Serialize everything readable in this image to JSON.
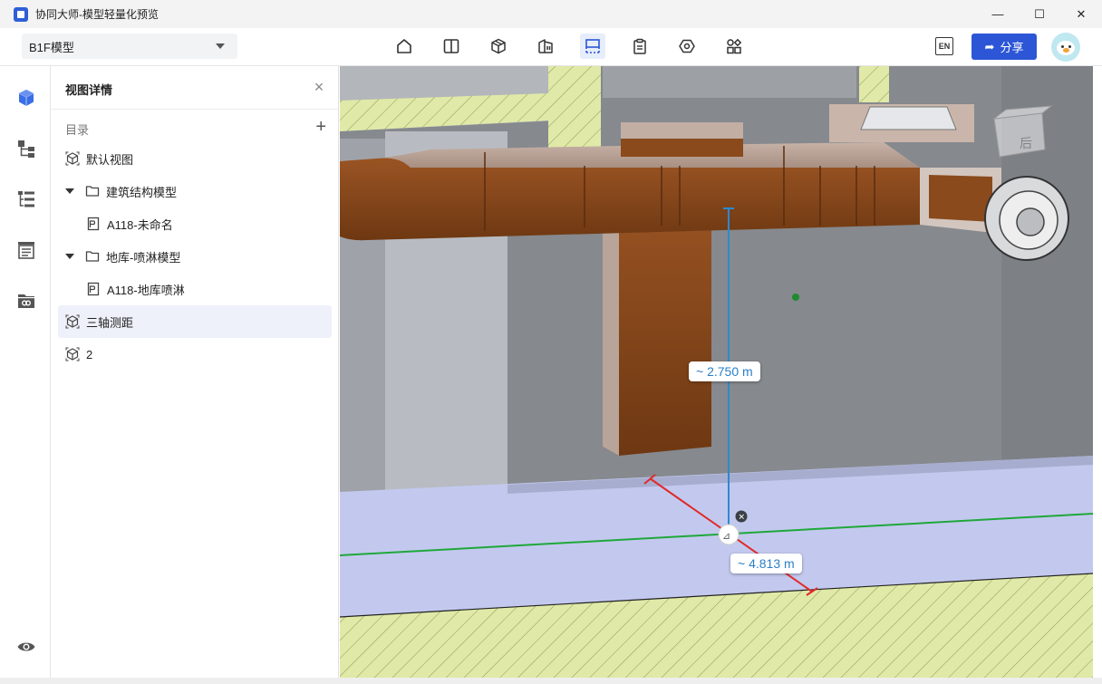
{
  "window": {
    "title": "协同大师-模型轻量化预览",
    "controls": {
      "minimize": "—",
      "maximize": "☐",
      "close": "✕"
    }
  },
  "toolbar": {
    "model_select": "B1F模型",
    "tools": [
      {
        "name": "home-icon",
        "active": false
      },
      {
        "name": "split-view-icon",
        "active": false
      },
      {
        "name": "model-box-icon",
        "active": false
      },
      {
        "name": "building-icon",
        "active": false
      },
      {
        "name": "section-box-icon",
        "active": true
      },
      {
        "name": "clipboard-icon",
        "active": false
      },
      {
        "name": "settings-hex-icon",
        "active": false
      },
      {
        "name": "components-icon",
        "active": false
      }
    ],
    "lang_label": "EN",
    "share_label": "分享"
  },
  "rail": {
    "items": [
      "cube-icon",
      "hierarchy-icon",
      "list-tree-icon",
      "document-list-icon",
      "folder-link-icon"
    ],
    "bottom": "eye-icon"
  },
  "panel": {
    "title": "视图详情",
    "close": "×",
    "directory_label": "目录",
    "add": "+",
    "items": [
      {
        "label": "默认视图",
        "type": "view",
        "indent": 0
      },
      {
        "label": "建筑结构模型",
        "type": "folder",
        "indent": 0
      },
      {
        "label": "A118-未命名",
        "type": "sheet",
        "indent": 1
      },
      {
        "label": "地库-喷淋模型",
        "type": "folder",
        "indent": 0
      },
      {
        "label": "A118-地库喷淋",
        "type": "sheet",
        "indent": 1
      },
      {
        "label": "三轴测距",
        "type": "view",
        "indent": 0,
        "selected": true
      },
      {
        "label": "2",
        "type": "view",
        "indent": 0
      }
    ]
  },
  "viewport": {
    "measure_vertical": "~ 2.750 m",
    "measure_horizontal": "~ 4.813 m",
    "viewcube_label": "后",
    "colors": {
      "duct": "#8a4a1c",
      "floor": "#c3c9ee",
      "hatch": "#dfe9a6",
      "wall": "#86898e",
      "column": "#b8bcc2",
      "measure_blue": "#2a8ad0",
      "measure_red": "#e02a2a",
      "measure_green": "#1ea83a"
    }
  }
}
